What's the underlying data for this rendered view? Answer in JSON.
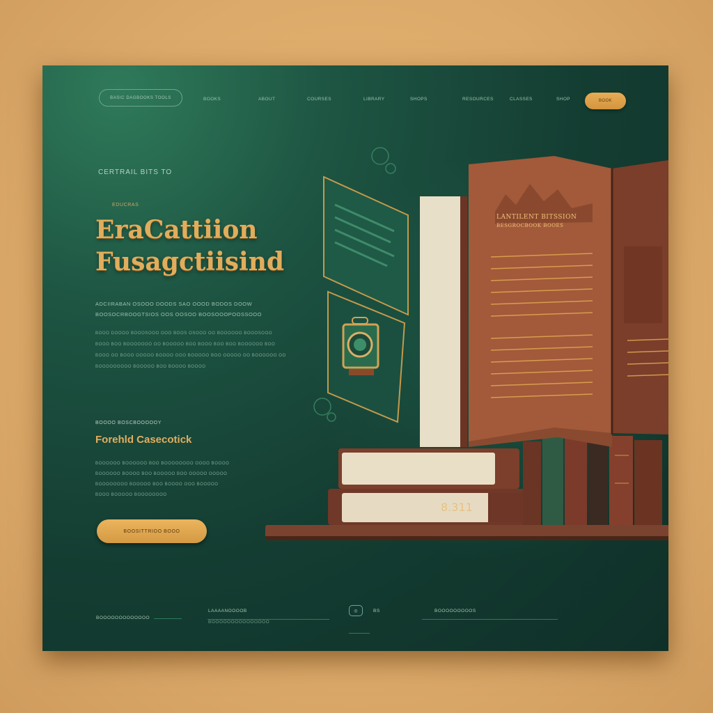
{
  "nav": {
    "pill_label": "BASIC DAGBOOKS TOOLS",
    "links": [
      "BOOKS",
      "ABOUT",
      "COURSES",
      "LIBRARY",
      "SHOPS",
      "RESOURCES",
      "CLASSES",
      "SHOP"
    ],
    "cta_label": "BOOK"
  },
  "hero": {
    "eyebrow": "CERTRAIL BITS TO",
    "small_tag": "EDUCRAS",
    "title_line1": "EraCattiion",
    "title_line2": "Fusagctiisind",
    "desc_lead_1": "ADCIIRABAN OSOOO DOODS SAO OOOD BODOS DOOW",
    "desc_lead_2": "BOOSOCRBOOGTSIOS OOS OOSOO BOOSOOOPOOSSOOO",
    "desc_lines": [
      "BOOO DOOOO BOOOSOOO OOO BOOS OSOOO OO BOOOOOO BOOOSOOO",
      "BOOO BOO BOOOOOOO OO BOOOOO BOO BOOO BOO BOO BOOOOOO BOO",
      "BOOO OO BOOO OOOOO BOOOO OOO BOOOOO BOO OOOOO OO BOOOOOO OO",
      "BOOOOOOOOO BOOOOO BOO BOOOO BOOOO"
    ],
    "sub_tag": "BOOOO BOSCBOOOOOY",
    "sub_title": "Forehld Casecotick",
    "sub_lines": [
      "BOOOOOO BOOOOOO BOO BOOOOOOOO OOOO BOOOO",
      "BOOOOOO BOOOO BOO BOOOOO BOO OOOOO OOOOO",
      "BOOOOOOOO BOOOOO BOO BOOOO OOO BOOOOO",
      "BOOO BOOOOO BOOOOOOOO"
    ],
    "cta_label": "BOOSITTRIOO BOOO"
  },
  "book": {
    "page_title_1": "LANTILENT BITSSION",
    "page_title_2": "BESGROCBOOK BOOES",
    "spine_label": "8.311"
  },
  "footer": {
    "left_text": "BOOOOOOOOOOOOO",
    "mid_title": "LAAAANOOOOB",
    "mid_sub": "BOOOOOOOOOOOOOOO",
    "icon_label": "BS",
    "right_title": "BOOOOOOOOOS"
  },
  "colors": {
    "accent": "#e1ad5c",
    "panel": "#143d32",
    "backdrop": "#dcaa6a"
  }
}
